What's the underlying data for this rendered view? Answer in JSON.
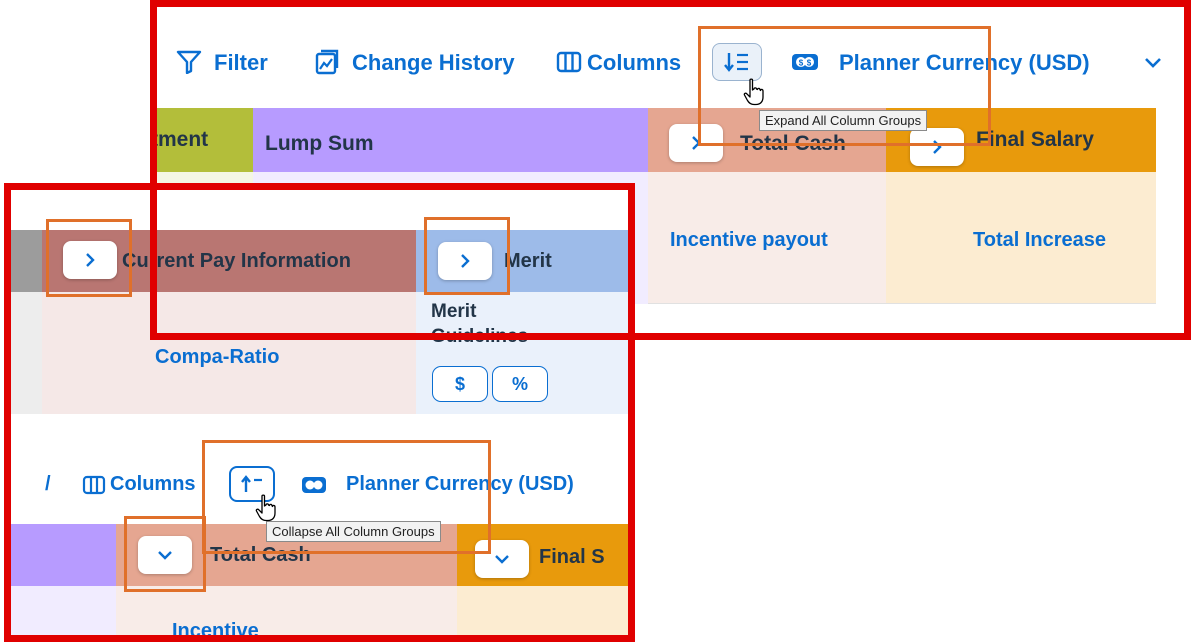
{
  "top": {
    "toolbar": {
      "filter": "Filter",
      "change_history": "Change History",
      "columns": "Columns",
      "planner_currency": "Planner Currency (USD)"
    },
    "tooltip": "Expand All Column Groups",
    "groups": {
      "adjustment": "tment",
      "lump_sum": "Lump Sum",
      "total_cash": "Total Cash",
      "final_salary": "Final Salary"
    },
    "cells": {
      "incentive_payout": "Incentive payout",
      "total_increase": "Total Increase"
    }
  },
  "bottom": {
    "groups": {
      "current_pay": "Current Pay Information",
      "merit": "Merit"
    },
    "cells": {
      "compa_ratio": "Compa-Ratio",
      "merit_guidelines_1": "Merit",
      "merit_guidelines_2": "Guidelines",
      "seg_dollar": "$",
      "seg_percent": "%"
    },
    "toolbar": {
      "slash": "/",
      "columns": "Columns",
      "planner_currency": "Planner Currency (USD)"
    },
    "tooltip": "Collapse All Column Groups",
    "groups2": {
      "total_cash": "Total Cash",
      "final_salary": "Final S"
    },
    "cells2": {
      "incentive": "Incentive"
    }
  },
  "colors": {
    "frame_red": "#e00000",
    "highlight_orange": "#e0702a",
    "link_blue": "#0a6ed1",
    "lump_sum_purple": "#b79bff",
    "adjustment_green": "#b3be3a",
    "total_cash_salmon": "#e5a691",
    "final_salary_orange": "#e89a0c",
    "current_pay_rose": "#b97672",
    "merit_blue": "#9dbbe9"
  }
}
